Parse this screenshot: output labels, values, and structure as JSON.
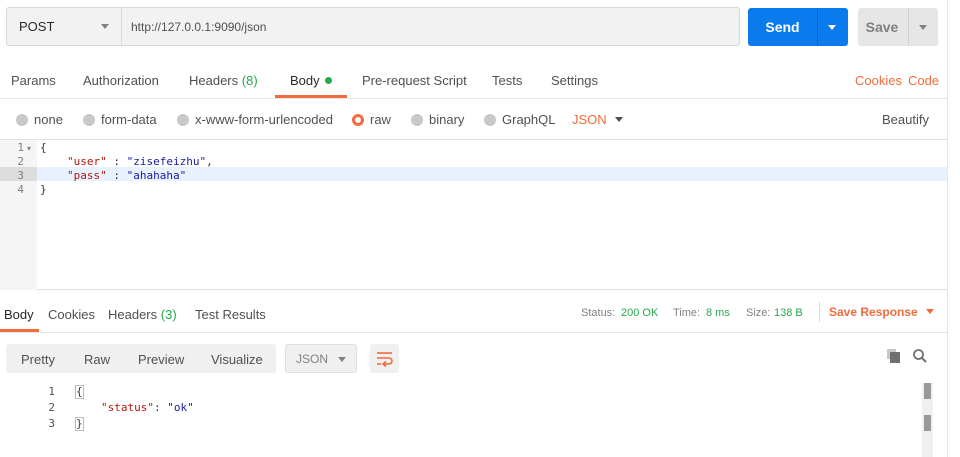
{
  "request": {
    "method": "POST",
    "url": "http://127.0.0.1:9090/json",
    "send_label": "Send",
    "save_label": "Save"
  },
  "req_tabs": {
    "params": "Params",
    "authorization": "Authorization",
    "headers": "Headers",
    "headers_count": "(8)",
    "body": "Body",
    "prerequest": "Pre-request Script",
    "tests": "Tests",
    "settings": "Settings",
    "cookies": "Cookies",
    "code": "Code"
  },
  "body_types": {
    "none": "none",
    "form_data": "form-data",
    "urlencoded": "x-www-form-urlencoded",
    "raw": "raw",
    "binary": "binary",
    "graphql": "GraphQL",
    "format": "JSON",
    "beautify": "Beautify"
  },
  "request_body": {
    "line_numbers": [
      "1",
      "2",
      "3",
      "4"
    ],
    "open_brace": "{",
    "key1": "\"user\"",
    "sep1": " : ",
    "val1": "\"zisefeizhu\"",
    "comma": ",",
    "key2": "\"pass\"",
    "sep2": " : ",
    "val2": "\"ahahaha\"",
    "close_brace": "}"
  },
  "response_tabs": {
    "body": "Body",
    "cookies": "Cookies",
    "headers": "Headers",
    "headers_count": "(3)",
    "test_results": "Test Results"
  },
  "response_status": {
    "status_label": "Status:",
    "status_value": "200 OK",
    "time_label": "Time:",
    "time_value": "8 ms",
    "size_label": "Size:",
    "size_value": "138 B",
    "save_response": "Save Response"
  },
  "response_toolbar": {
    "pretty": "Pretty",
    "raw": "Raw",
    "preview": "Preview",
    "visualize": "Visualize",
    "format": "JSON"
  },
  "response_body": {
    "line_numbers": [
      "1",
      "2",
      "3"
    ],
    "open_brace": "{",
    "key": "\"status\"",
    "sep": ": ",
    "value": "\"ok\"",
    "close_brace": "}"
  },
  "colors": {
    "accent": "#f26b3a",
    "send": "#097bed",
    "status_ok": "#26a94b"
  },
  "icons": [
    "chevron-down-icon",
    "copy-icon",
    "search-icon",
    "wrap-lines-icon",
    "fold-arrow-icon"
  ]
}
